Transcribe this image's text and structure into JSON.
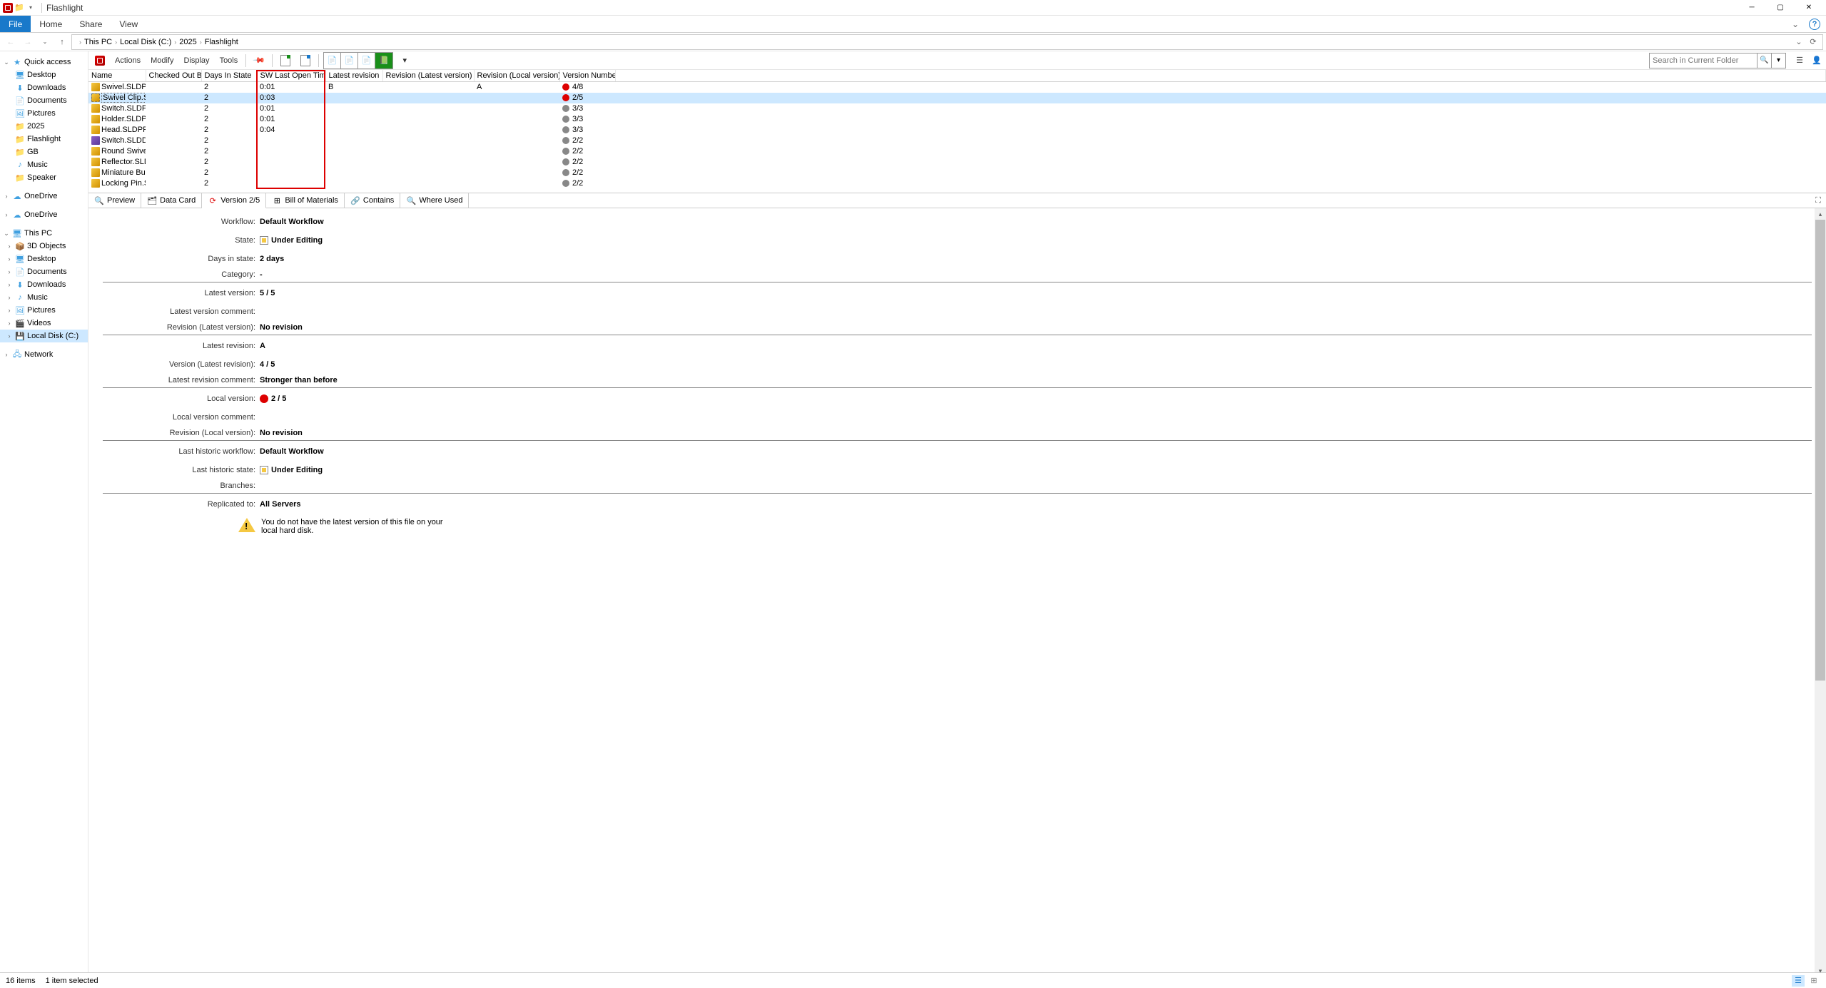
{
  "window": {
    "title": "Flashlight"
  },
  "ribbon": {
    "file": "File",
    "home": "Home",
    "share": "Share",
    "view": "View"
  },
  "address": {
    "crumbs": [
      "This PC",
      "Local Disk (C:)",
      "2025",
      "Flashlight"
    ]
  },
  "navtree": {
    "quick_access": "Quick access",
    "desktop": "Desktop",
    "downloads": "Downloads",
    "documents": "Documents",
    "pictures": "Pictures",
    "y2025": "2025",
    "flashlight": "Flashlight",
    "gb": "GB",
    "music": "Music",
    "speaker": "Speaker",
    "onedrive1": "OneDrive",
    "onedrive2": "OneDrive",
    "thispc": "This PC",
    "objects3d": "3D Objects",
    "desktop2": "Desktop",
    "documents2": "Documents",
    "downloads2": "Downloads",
    "music2": "Music",
    "pictures2": "Pictures",
    "videos": "Videos",
    "localdisk": "Local Disk (C:)",
    "network": "Network"
  },
  "pdm_toolbar": {
    "actions": "Actions",
    "modify": "Modify",
    "display": "Display",
    "tools": "Tools",
    "search_placeholder": "Search in Current Folder"
  },
  "columns": {
    "name": "Name",
    "checked_out_by": "Checked Out By",
    "days_in_state": "Days In State",
    "sw_last_open_time": "SW Last Open Time",
    "latest_revision": "Latest revision",
    "revision_latest": "Revision (Latest version)",
    "revision_local": "Revision (Local version)",
    "version_number": "Version Number"
  },
  "files": [
    {
      "name": "Swivel.SLDPRT",
      "days": "2",
      "open": "0:01",
      "latest_rev": "B",
      "rev_latest": "",
      "rev_local": "A",
      "ver": "4/8",
      "warn": true,
      "asm": false,
      "sel": false
    },
    {
      "name": "Swivel Clip.S...",
      "days": "2",
      "open": "0:03",
      "latest_rev": "",
      "rev_latest": "",
      "rev_local": "",
      "ver": "2/5",
      "warn": true,
      "asm": false,
      "sel": true
    },
    {
      "name": "Switch.SLDPRT",
      "days": "2",
      "open": "0:01",
      "latest_rev": "",
      "rev_latest": "",
      "rev_local": "",
      "ver": "3/3",
      "warn": false,
      "asm": false,
      "sel": false
    },
    {
      "name": "Holder.SLDPRT",
      "days": "2",
      "open": "0:01",
      "latest_rev": "",
      "rev_latest": "",
      "rev_local": "",
      "ver": "3/3",
      "warn": false,
      "asm": false,
      "sel": false
    },
    {
      "name": "Head.SLDPRT",
      "days": "2",
      "open": "0:04",
      "latest_rev": "",
      "rev_latest": "",
      "rev_local": "",
      "ver": "3/3",
      "warn": false,
      "asm": false,
      "sel": false
    },
    {
      "name": "Switch.SLDD...",
      "days": "2",
      "open": "",
      "latest_rev": "",
      "rev_latest": "",
      "rev_local": "",
      "ver": "2/2",
      "warn": false,
      "asm": true,
      "sel": false
    },
    {
      "name": "Round Swivel..",
      "days": "2",
      "open": "",
      "latest_rev": "",
      "rev_latest": "",
      "rev_local": "",
      "ver": "2/2",
      "warn": false,
      "asm": false,
      "sel": false
    },
    {
      "name": "Reflector.SLD...",
      "days": "2",
      "open": "",
      "latest_rev": "",
      "rev_latest": "",
      "rev_local": "",
      "ver": "2/2",
      "warn": false,
      "asm": false,
      "sel": false
    },
    {
      "name": "Miniature Bul...",
      "days": "2",
      "open": "",
      "latest_rev": "",
      "rev_latest": "",
      "rev_local": "",
      "ver": "2/2",
      "warn": false,
      "asm": false,
      "sel": false
    },
    {
      "name": "Locking Pin.S...",
      "days": "2",
      "open": "",
      "latest_rev": "",
      "rev_latest": "",
      "rev_local": "",
      "ver": "2/2",
      "warn": false,
      "asm": false,
      "sel": false
    }
  ],
  "detail_tabs": {
    "preview": "Preview",
    "data_card": "Data Card",
    "version": "Version 2/5",
    "bom": "Bill of Materials",
    "contains": "Contains",
    "where_used": "Where Used"
  },
  "details": {
    "workflow_label": "Workflow:",
    "workflow": "Default Workflow",
    "state_label": "State:",
    "state": "Under Editing",
    "days_in_state_label": "Days in state:",
    "days_in_state": "2 days",
    "category_label": "Category:",
    "category": "-",
    "latest_version_label": "Latest version:",
    "latest_version": "5 / 5",
    "latest_version_comment_label": "Latest version comment:",
    "latest_version_comment": "",
    "revision_latest_label": "Revision (Latest version):",
    "revision_latest": "No revision",
    "latest_revision_label": "Latest revision:",
    "latest_revision": "A",
    "version_latest_rev_label": "Version (Latest revision):",
    "version_latest_rev": "4 / 5",
    "latest_rev_comment_label": "Latest revision comment:",
    "latest_rev_comment": "Stronger than before",
    "local_version_label": "Local version:",
    "local_version": "2 / 5",
    "local_version_comment_label": "Local version comment:",
    "local_version_comment": "",
    "revision_local_label": "Revision (Local version):",
    "revision_local": "No revision",
    "last_historic_workflow_label": "Last historic workflow:",
    "last_historic_workflow": "Default Workflow",
    "last_historic_state_label": "Last historic state:",
    "last_historic_state": "Under Editing",
    "branches_label": "Branches:",
    "branches": "",
    "replicated_label": "Replicated to:",
    "replicated": "All Servers",
    "warning": "You do not have the latest version of this file on your local hard disk."
  },
  "statusbar": {
    "items": "16 items",
    "selected": "1 item selected"
  }
}
